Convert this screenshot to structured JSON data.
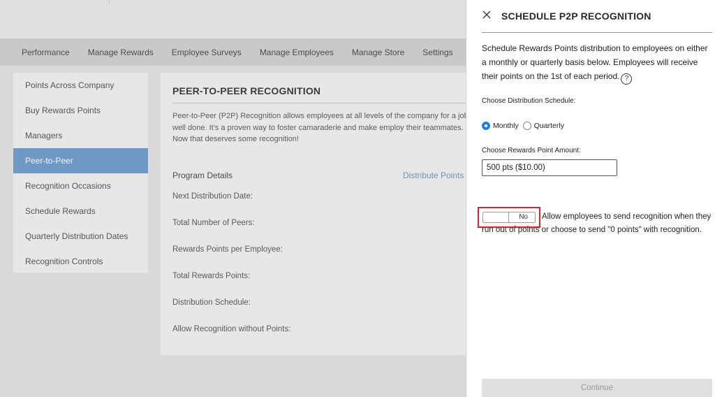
{
  "nav": {
    "tabs": [
      "Performance",
      "Manage Rewards",
      "Employee Surveys",
      "Manage Employees",
      "Manage Store",
      "Settings"
    ]
  },
  "sidebar": {
    "items": [
      {
        "label": "Points Across Company",
        "active": false
      },
      {
        "label": "Buy Rewards Points",
        "active": false
      },
      {
        "label": "Managers",
        "active": false
      },
      {
        "label": "Peer-to-Peer",
        "active": true
      },
      {
        "label": "Recognition Occasions",
        "active": false
      },
      {
        "label": "Schedule Rewards",
        "active": false
      },
      {
        "label": "Quarterly Distribution Dates",
        "active": false
      },
      {
        "label": "Recognition Controls",
        "active": false
      }
    ]
  },
  "main": {
    "title": "PEER-TO-PEER RECOGNITION",
    "description": "Peer-to-Peer (P2P) Recognition allows employees at all levels of the company for a job well done. It's a proven way to foster camaraderie and make employ their teammates. Now that deserves some recognition!",
    "program_details_label": "Program Details",
    "distribute_link": "Distribute Points",
    "details": [
      "Next Distribution Date:",
      "Total Number of Peers:",
      "Rewards Points per Employee:",
      "Total Rewards Points:",
      "Distribution Schedule:",
      "Allow Recognition without Points:"
    ]
  },
  "panel": {
    "title": "SCHEDULE P2P RECOGNITION",
    "description": "Schedule Rewards Points distribution to employees on either a monthly or quarterly basis below. Employees will receive their points on the 1st of each period.",
    "help_glyph": "?",
    "schedule_label": "Choose Distribution Schedule:",
    "schedule_options": [
      "Monthly",
      "Quarterly"
    ],
    "schedule_selected": "Monthly",
    "amount_label": "Choose Rewards Point Amount:",
    "amount_value": "500 pts ($10.00)",
    "toggle_value": "No",
    "toggle_description": "Allow employees to send recognition when they run out of points or choose to send \"0 points\" with recognition.",
    "continue_label": "Continue",
    "close_icon": "close-icon",
    "accent_color": "#1e80e0",
    "highlight_color": "#e0202a"
  }
}
